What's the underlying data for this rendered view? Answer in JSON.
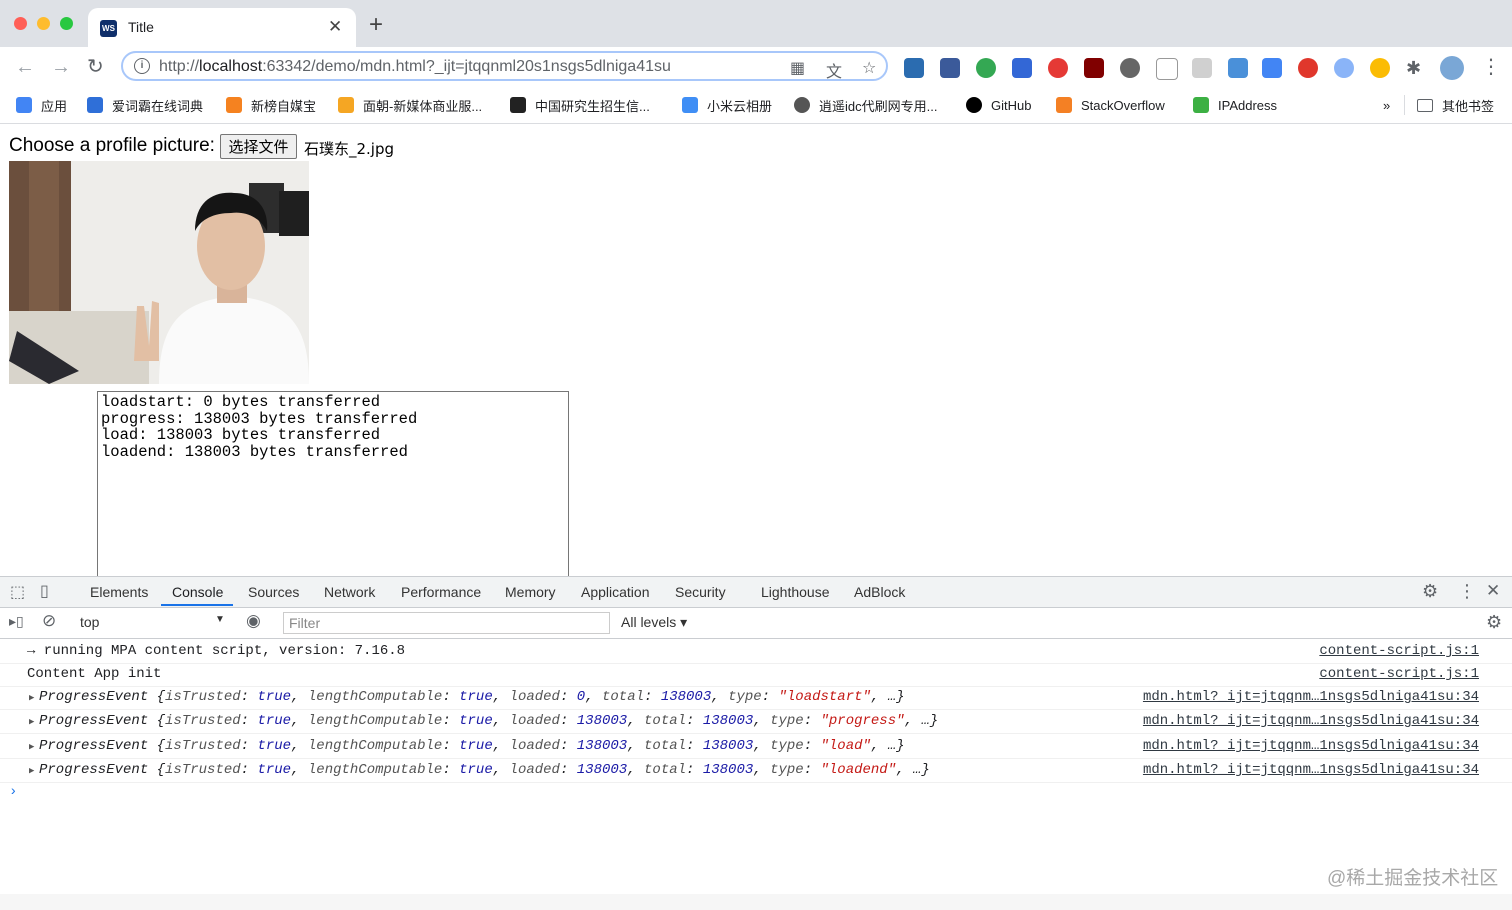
{
  "browser": {
    "tab_title": "Title",
    "url_host_prefix": "http://",
    "url_host": "localhost",
    "url_rest": ":63342/demo/mdn.html?_ijt=jtqqnml20s1nsgs5dlniga41su"
  },
  "bookmarks": {
    "items": [
      "应用",
      "爱词霸在线词典",
      "新榜自媒宝",
      "面朝-新媒体商业服...",
      "中国研究生招生信...",
      "小米云相册",
      "逍遥idc代刷网专用...",
      "GitHub",
      "StackOverflow",
      "IPAddress"
    ],
    "more": "»",
    "other": "其他书签"
  },
  "page": {
    "choose_label": "Choose a profile picture:",
    "file_button": "选择文件",
    "file_name": "石璞东_2.jpg",
    "log_lines": [
      "loadstart: 0 bytes transferred",
      "progress: 138003 bytes transferred",
      "load: 138003 bytes transferred",
      "loadend: 138003 bytes transferred"
    ]
  },
  "devtools": {
    "tabs": [
      "Elements",
      "Console",
      "Sources",
      "Network",
      "Performance",
      "Memory",
      "Application",
      "Security",
      "Lighthouse",
      "AdBlock"
    ],
    "active_tab": "Console",
    "context": "top",
    "filter_placeholder": "Filter",
    "levels": "All levels ▾",
    "console": {
      "line1": "→ running MPA content script, version: 7.16.8",
      "line1_src": "content-script.js:1",
      "line2": "Content App init",
      "line2_src": "content-script.js:1",
      "events": [
        {
          "loaded": "0",
          "total": "138003",
          "type": "\"loadstart\"",
          "src": "mdn.html?_ijt=jtqqnm…1nsgs5dlniga41su:34"
        },
        {
          "loaded": "138003",
          "total": "138003",
          "type": "\"progress\"",
          "src": "mdn.html?_ijt=jtqqnm…1nsgs5dlniga41su:34"
        },
        {
          "loaded": "138003",
          "total": "138003",
          "type": "\"load\"",
          "src": "mdn.html?_ijt=jtqqnm…1nsgs5dlniga41su:34"
        },
        {
          "loaded": "138003",
          "total": "138003",
          "type": "\"loadend\"",
          "src": "mdn.html?_ijt=jtqqnm…1nsgs5dlniga41su:34"
        }
      ],
      "pe_name": "ProgressEvent",
      "k_trusted": "isTrusted",
      "v_true": "true",
      "k_len": "lengthComputable",
      "k_loaded": "loaded",
      "k_total": "total",
      "k_type": "type",
      "prompt": "›"
    },
    "watermark": "@稀土掘金技术社区"
  },
  "colors": {
    "accent": "#1a73e8",
    "tabstrip": "#dee1e6"
  }
}
